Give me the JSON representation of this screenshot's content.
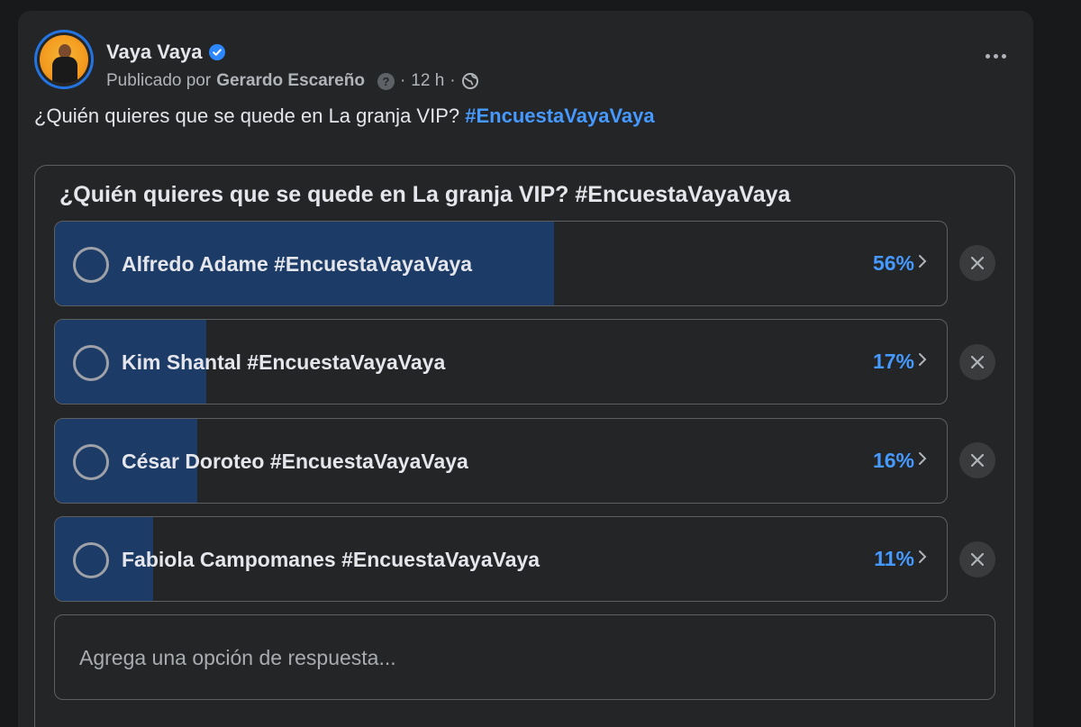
{
  "post": {
    "page_name": "Vaya Vaya",
    "verified": true,
    "published_by_prefix": "Publicado por",
    "author": "Gerardo Escareño",
    "help_icon_text": "?",
    "time": "12 h",
    "separator": "·",
    "audience_icon": "globe-icon",
    "text": "¿Quién quieres que se quede en La granja VIP?",
    "hashtag": "#EncuestaVayaVaya"
  },
  "poll": {
    "title": "¿Quién quieres que se quede en La granja VIP? #EncuestaVayaVaya",
    "options": [
      {
        "label": "Alfredo Adame #EncuestaVayaVaya",
        "percent_label": "56%",
        "percent": 56
      },
      {
        "label": "Kim Shantal #EncuestaVayaVaya",
        "percent_label": "17%",
        "percent": 17
      },
      {
        "label": "César Doroteo #EncuestaVayaVaya",
        "percent_label": "16%",
        "percent": 16
      },
      {
        "label": "Fabiola Campomanes #EncuestaVayaVaya",
        "percent_label": "11%",
        "percent": 11
      }
    ],
    "add_option_placeholder": "Agrega una opción de respuesta..."
  },
  "colors": {
    "background": "#18191a",
    "card": "#242526",
    "accent_blue": "#4599ff",
    "fill_bar": "#1c3b66"
  }
}
